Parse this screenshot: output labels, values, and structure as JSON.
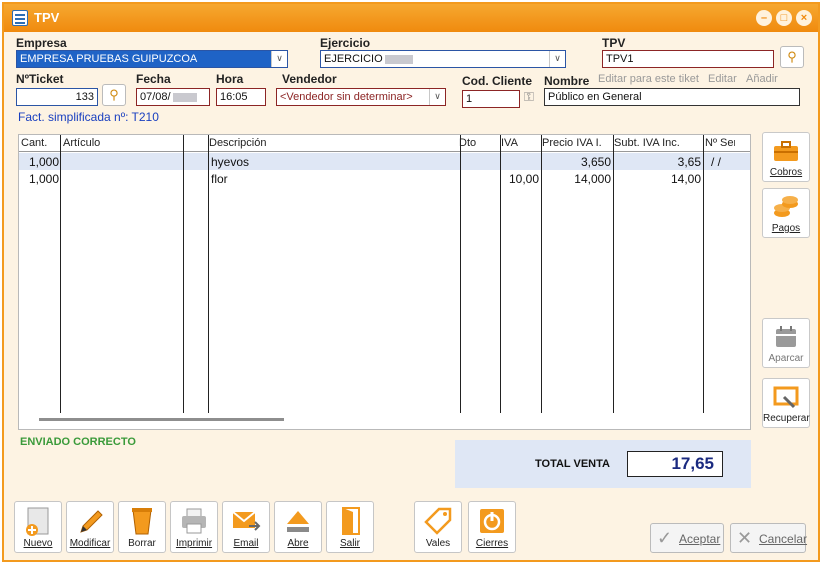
{
  "window": {
    "title": "TPV"
  },
  "header": {
    "empresa": {
      "label": "Empresa",
      "value": "EMPRESA PRUEBAS GUIPUZCOA"
    },
    "ejercicio": {
      "label": "Ejercicio",
      "value": "EJERCICIO"
    },
    "tpv": {
      "label": "TPV",
      "value": "TPV1"
    },
    "ticket": {
      "label": "NºTicket",
      "value": "133"
    },
    "fecha": {
      "label": "Fecha",
      "value": "07/08/"
    },
    "hora": {
      "label": "Hora",
      "value": "16:05"
    },
    "vendedor": {
      "label": "Vendedor",
      "value": "<Vendedor sin determinar>"
    },
    "cod_cliente": {
      "label": "Cod. Cliente",
      "value": "1"
    },
    "nombre": {
      "label": "Nombre",
      "value": "Público en General"
    },
    "links": {
      "editar_ticket": "Editar para este tiket",
      "editar": "Editar",
      "anadir": "Añadir"
    },
    "fact_simplificada": "Fact. simplificada nº: T210"
  },
  "grid": {
    "columns": [
      "Cant.",
      "Artículo",
      "Descripción",
      "Dto",
      "IVA",
      "Precio IVA I.",
      "Subt. IVA Inc.",
      "Nº Ser"
    ],
    "rows": [
      {
        "cant": "1,000",
        "articulo": "",
        "descripcion": "hyevos",
        "dto": "",
        "iva": "",
        "precio": "3,650",
        "subtotal": "3,65",
        "serie": "/ /"
      },
      {
        "cant": "1,000",
        "articulo": "",
        "descripcion": "flor",
        "dto": "",
        "iva": "10,00",
        "precio": "14,000",
        "subtotal": "14,00",
        "serie": ""
      }
    ]
  },
  "side_buttons": {
    "cobros": "Cobros",
    "pagos": "Pagos",
    "aparcar": "Aparcar",
    "recuperar": "Recuperar"
  },
  "status": "ENVIADO CORRECTO",
  "total": {
    "label": "TOTAL VENTA",
    "value": "17,65"
  },
  "toolbar": {
    "nuevo": "Nuevo",
    "modificar": "Modificar",
    "borrar": "Borrar",
    "imprimir": "Imprimir",
    "email": "Email",
    "abre": "Abre",
    "salir": "Salir",
    "vales": "Vales",
    "cierres": "Cierres"
  },
  "actions": {
    "aceptar": "Aceptar",
    "cancelar": "Cancelar"
  },
  "colors": {
    "accent": "#f39a1e",
    "selection": "#1f63c6",
    "status_ok": "#3a9a3a",
    "total_panel": "#dfe7f5"
  }
}
